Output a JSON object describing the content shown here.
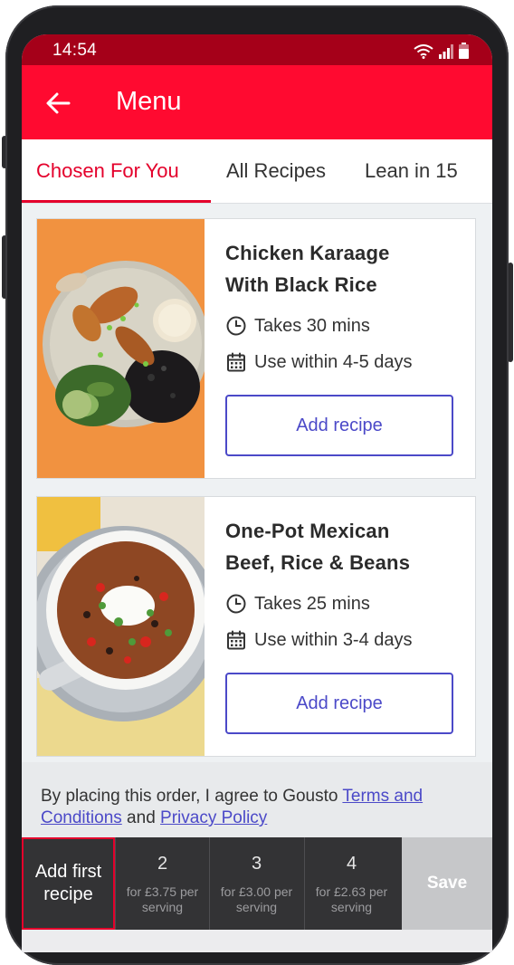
{
  "status_bar": {
    "time": "14:54"
  },
  "app_bar": {
    "title": "Menu",
    "back_icon": "arrow-left-icon"
  },
  "tabs": [
    {
      "label": "Chosen For You",
      "active": true
    },
    {
      "label": "All Recipes",
      "active": false
    },
    {
      "label": "Lean in 15",
      "active": false
    }
  ],
  "recipes": [
    {
      "title_line1": "Chicken Karaage",
      "title_line2": "With Black Rice",
      "time": "Takes 30 mins",
      "use_within": "Use within 4-5 days",
      "button": "Add recipe"
    },
    {
      "title_line1": "One-Pot Mexican",
      "title_line2": "Beef, Rice & Beans",
      "time": "Takes 25 mins",
      "use_within": "Use within 3-4 days",
      "button": "Add recipe"
    }
  ],
  "consent": {
    "text_before": "By placing this order, I agree to Gousto ",
    "terms_link": "Terms and Conditions",
    "text_middle": " and ",
    "privacy_link": "Privacy Policy"
  },
  "portion_bar": {
    "first_label_line1": "Add first",
    "first_label_line2": "recipe",
    "options": [
      {
        "count": "2",
        "price_line1": "for £3.75 per",
        "price_line2": "serving"
      },
      {
        "count": "3",
        "price_line1": "for £3.00 per",
        "price_line2": "serving"
      },
      {
        "count": "4",
        "price_line1": "for £2.63 per",
        "price_line2": "serving"
      }
    ],
    "save_label": "Save"
  },
  "colors": {
    "brand_red": "#ff0a30",
    "status_red": "#a50019",
    "accent_purple": "#4b49c8"
  }
}
